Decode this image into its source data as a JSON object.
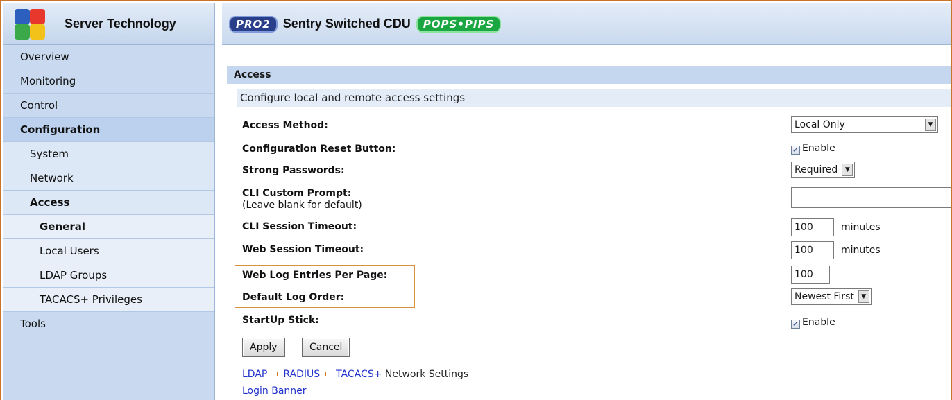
{
  "brand": {
    "name": "Server Technology",
    "logo_icon": "server-technology-logo"
  },
  "header": {
    "badge_pro": "PRO2",
    "product": "Sentry Switched CDU",
    "badge_pops": "POPS•PIPS"
  },
  "sidebar": {
    "items": [
      {
        "label": "Overview"
      },
      {
        "label": "Monitoring"
      },
      {
        "label": "Control"
      },
      {
        "label": "Configuration"
      },
      {
        "label": "System"
      },
      {
        "label": "Network"
      },
      {
        "label": "Access"
      },
      {
        "label": "General"
      },
      {
        "label": "Local Users"
      },
      {
        "label": "LDAP Groups"
      },
      {
        "label": "TACACS+ Privileges"
      },
      {
        "label": "Tools"
      }
    ]
  },
  "section": {
    "title": "Access",
    "subtitle": "Configure local and remote access settings"
  },
  "form": {
    "access_method": {
      "label": "Access Method:",
      "value": "Local Only"
    },
    "config_reset": {
      "label": "Configuration Reset Button:",
      "checked": true,
      "option": "Enable"
    },
    "strong_passwords": {
      "label": "Strong Passwords:",
      "value": "Required"
    },
    "cli_prompt": {
      "label": "CLI Custom Prompt:",
      "hint": "(Leave blank for default)",
      "value": ""
    },
    "cli_timeout": {
      "label": "CLI Session Timeout:",
      "value": "100",
      "unit": "minutes"
    },
    "web_timeout": {
      "label": "Web Session Timeout:",
      "value": "100",
      "unit": "minutes"
    },
    "web_log_entries": {
      "label": "Web Log Entries Per Page:",
      "value": "100"
    },
    "default_log_order": {
      "label": "Default Log Order:",
      "value": "Newest First"
    },
    "startup_stick": {
      "label": "StartUp Stick:",
      "checked": true,
      "option": "Enable"
    }
  },
  "buttons": {
    "apply": "Apply",
    "cancel": "Cancel"
  },
  "links": {
    "ldap": "LDAP",
    "radius": "RADIUS",
    "tacacs": "TACACS+",
    "network_settings_suffix": " Network Settings",
    "login_banner": "Login Banner"
  },
  "colors": {
    "accent_border": "#c8742a",
    "sidebar_bg": "#c9daf0",
    "link": "#2233cc"
  }
}
